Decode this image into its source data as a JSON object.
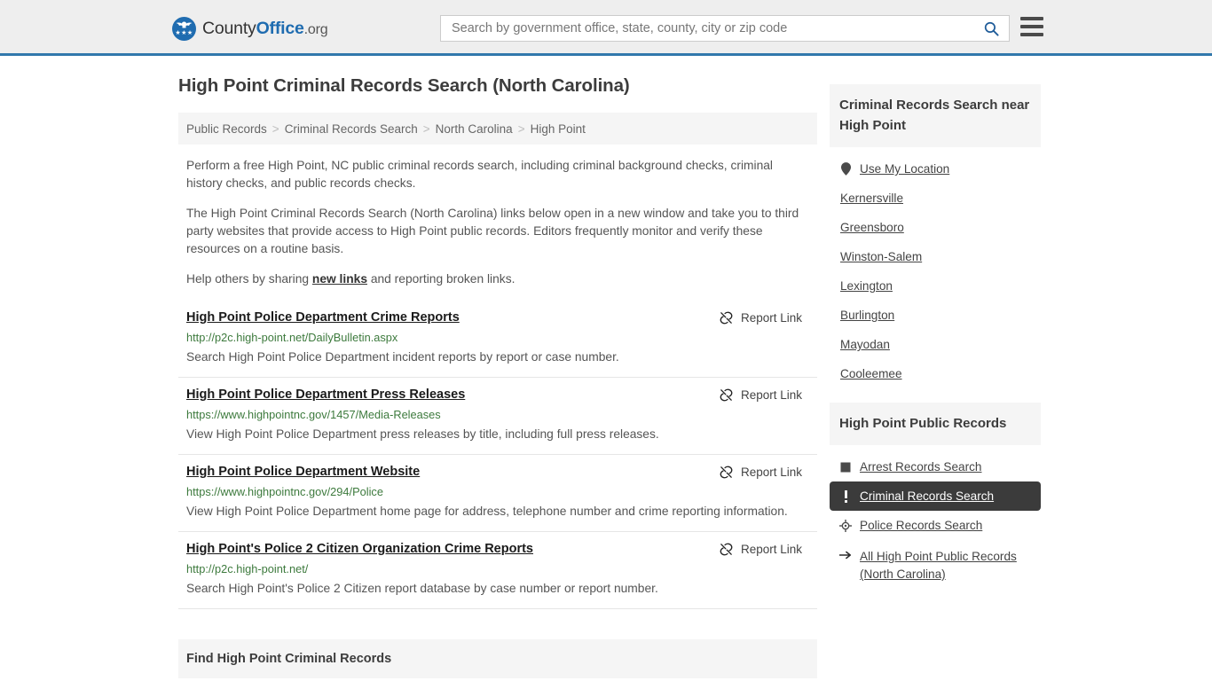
{
  "header": {
    "logo": {
      "part1": "County",
      "part2": "Office",
      "part3": ".org"
    },
    "search": {
      "placeholder": "Search by government office, state, county, city or zip code",
      "value": "",
      "button_icon": "search-icon"
    },
    "menu_icon": "hamburger-menu-icon"
  },
  "main": {
    "page_title": "High Point Criminal Records Search (North Carolina)",
    "breadcrumb": {
      "separator": ">",
      "items": [
        {
          "label": "Public Records",
          "current": false
        },
        {
          "label": "Criminal Records Search",
          "current": false
        },
        {
          "label": "North Carolina",
          "current": false
        },
        {
          "label": "High Point",
          "current": true
        }
      ]
    },
    "intro": {
      "p1": "Perform a free High Point, NC public criminal records search, including criminal background checks, criminal history checks, and public records checks.",
      "p2": "The High Point Criminal Records Search (North Carolina) links below open in a new window and take you to third party websites that provide access to High Point public records. Editors frequently monitor and verify these resources on a routine basis.",
      "p3_pre": "Help others by sharing ",
      "p3_link": "new links",
      "p3_post": " and reporting broken links."
    },
    "report_link_label": "Report Link",
    "results": [
      {
        "title": "High Point Police Department Crime Reports",
        "url": "http://p2c.high-point.net/DailyBulletin.aspx",
        "description": "Search High Point Police Department incident reports by report or case number."
      },
      {
        "title": "High Point Police Department Press Releases",
        "url": "https://www.highpointnc.gov/1457/Media-Releases",
        "description": "View High Point Police Department press releases by title, including full press releases."
      },
      {
        "title": "High Point Police Department Website",
        "url": "https://www.highpointnc.gov/294/Police",
        "description": "View High Point Police Department home page for address, telephone number and crime reporting information."
      },
      {
        "title": "High Point's Police 2 Citizen Organization Crime Reports",
        "url": "http://p2c.high-point.net/",
        "description": "Search High Point's Police 2 Citizen report database by case number or report number."
      }
    ],
    "bottom_section_title": "Find High Point Criminal Records"
  },
  "sidebar": {
    "nearby": {
      "heading": "Criminal Records Search near High Point",
      "items": [
        {
          "label": "Use My Location",
          "icon": "map-pin-icon"
        },
        {
          "label": "Kernersville",
          "icon": ""
        },
        {
          "label": "Greensboro",
          "icon": ""
        },
        {
          "label": "Winston-Salem",
          "icon": ""
        },
        {
          "label": "Lexington",
          "icon": ""
        },
        {
          "label": "Burlington",
          "icon": ""
        },
        {
          "label": "Mayodan",
          "icon": ""
        },
        {
          "label": "Cooleemee",
          "icon": ""
        }
      ]
    },
    "public_records": {
      "heading": "High Point Public Records",
      "items": [
        {
          "label": "Arrest Records Search",
          "icon": "handcuffs-icon",
          "active": false,
          "multiline": false
        },
        {
          "label": "Criminal Records Search",
          "icon": "exclamation-icon",
          "active": true,
          "multiline": false
        },
        {
          "label": "Police Records Search",
          "icon": "police-badge-icon",
          "active": false,
          "multiline": false
        },
        {
          "label": "All High Point Public Records (North Carolina)",
          "icon": "arrow-right-icon",
          "active": false,
          "multiline": true
        }
      ]
    }
  },
  "colors": {
    "brand_blue": "#1f6cb0",
    "header_rule": "#3178ac",
    "header_bg": "#eeeeee",
    "url_green": "#3d7a3d",
    "panel_gray": "#f5f5f5",
    "active_dark": "#3b3b3b"
  }
}
